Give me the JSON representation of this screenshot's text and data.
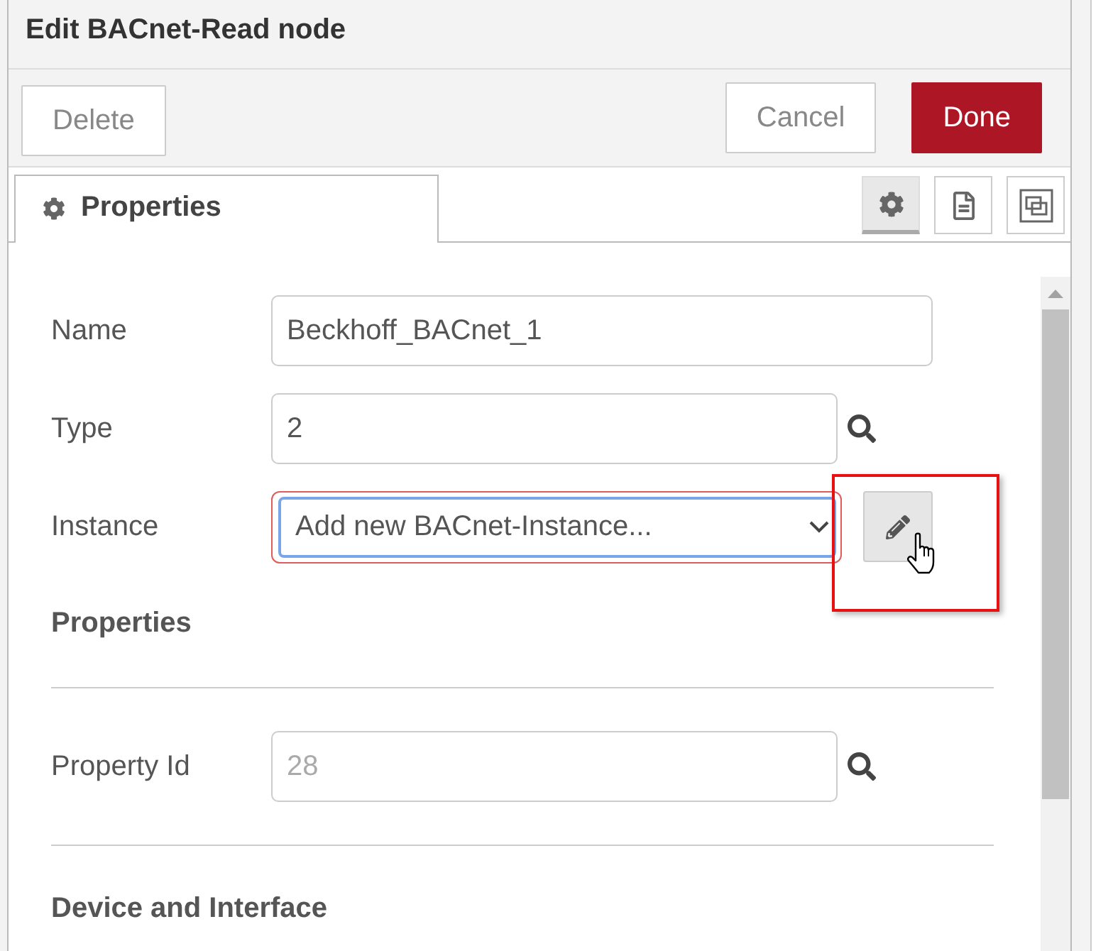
{
  "dialog": {
    "title": "Edit BACnet-Read node"
  },
  "toolbar": {
    "left_buttons": [
      {
        "label": "Delete",
        "kind": "plain"
      }
    ],
    "right_buttons": [
      {
        "label": "Cancel",
        "kind": "plain"
      },
      {
        "label": "Done",
        "kind": "primary"
      }
    ]
  },
  "tabs": [
    {
      "label": "Properties",
      "selected": true
    }
  ],
  "tab_buttons": [
    {
      "kind": "gear",
      "selected": true
    },
    {
      "kind": "document",
      "selected": false
    },
    {
      "kind": "frame",
      "selected": false
    }
  ],
  "form": {
    "items": [
      {
        "kind": "field",
        "label": "Name",
        "input": {
          "kind": "text",
          "value": "Beckhoff_BACnet_1"
        }
      },
      {
        "kind": "field",
        "label": "Type",
        "input": {
          "kind": "text",
          "value": "2"
        },
        "action": {
          "kind": "lookup"
        }
      },
      {
        "kind": "field",
        "label": "Instance",
        "input": {
          "kind": "select",
          "value": "Add new BACnet-Instance...",
          "invalid": true,
          "focused": true
        },
        "action": {
          "kind": "edit",
          "highlighted": true,
          "hovered": true
        }
      },
      {
        "kind": "heading",
        "text": "Properties"
      },
      {
        "kind": "divider"
      },
      {
        "kind": "field",
        "label": "Property Id",
        "input": {
          "kind": "text",
          "placeholder": "28"
        },
        "action": {
          "kind": "lookup"
        }
      },
      {
        "kind": "divider"
      },
      {
        "kind": "heading",
        "text": "Device and Interface"
      }
    ]
  }
}
